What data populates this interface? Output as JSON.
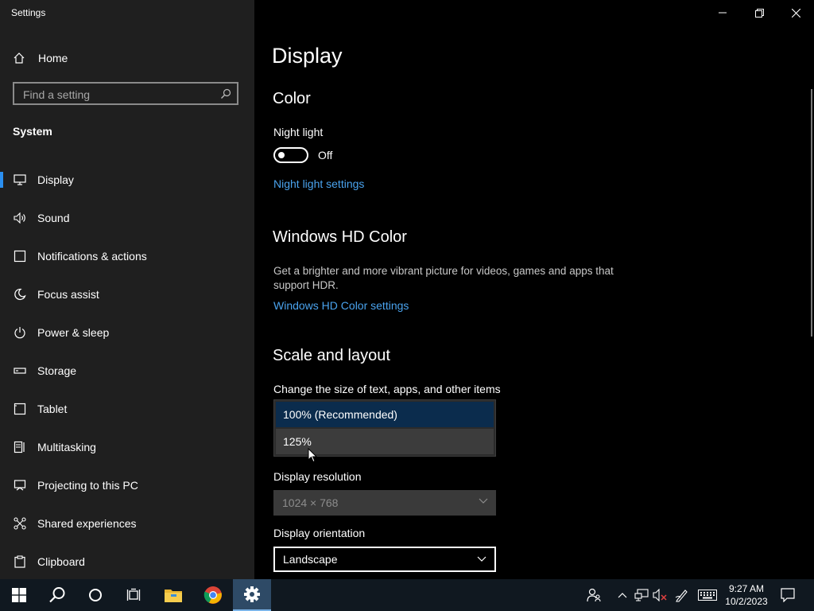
{
  "window": {
    "title": "Settings"
  },
  "sidebar": {
    "home_label": "Home",
    "search_placeholder": "Find a setting",
    "section_label": "System",
    "items": [
      {
        "label": "Display",
        "icon": "monitor-icon"
      },
      {
        "label": "Sound",
        "icon": "speaker-icon"
      },
      {
        "label": "Notifications & actions",
        "icon": "notification-icon"
      },
      {
        "label": "Focus assist",
        "icon": "moon-icon"
      },
      {
        "label": "Power & sleep",
        "icon": "power-icon"
      },
      {
        "label": "Storage",
        "icon": "storage-icon"
      },
      {
        "label": "Tablet",
        "icon": "tablet-icon"
      },
      {
        "label": "Multitasking",
        "icon": "multitasking-icon"
      },
      {
        "label": "Projecting to this PC",
        "icon": "projecting-icon"
      },
      {
        "label": "Shared experiences",
        "icon": "shared-experiences-icon"
      },
      {
        "label": "Clipboard",
        "icon": "clipboard-icon"
      }
    ]
  },
  "main": {
    "title": "Display",
    "color": {
      "heading": "Color",
      "night_light_label": "Night light",
      "night_light_state": "Off",
      "night_light_link": "Night light settings"
    },
    "hd_color": {
      "heading": "Windows HD Color",
      "description": "Get a brighter and more vibrant picture for videos, games and apps that support HDR.",
      "link": "Windows HD Color settings"
    },
    "scale": {
      "heading": "Scale and layout",
      "size_label": "Change the size of text, apps, and other items",
      "options": [
        "100% (Recommended)",
        "125%"
      ],
      "resolution_label": "Display resolution",
      "resolution_value": "1024 × 768",
      "orientation_label": "Display orientation",
      "orientation_value": "Landscape"
    }
  },
  "taskbar": {
    "time": "9:27 AM",
    "date": "10/2/2023"
  },
  "colors": {
    "accent": "#2b8ff0",
    "link": "#4aa3ee",
    "sidebar_bg": "#1f1f1f",
    "taskbar_bg": "#101820"
  }
}
